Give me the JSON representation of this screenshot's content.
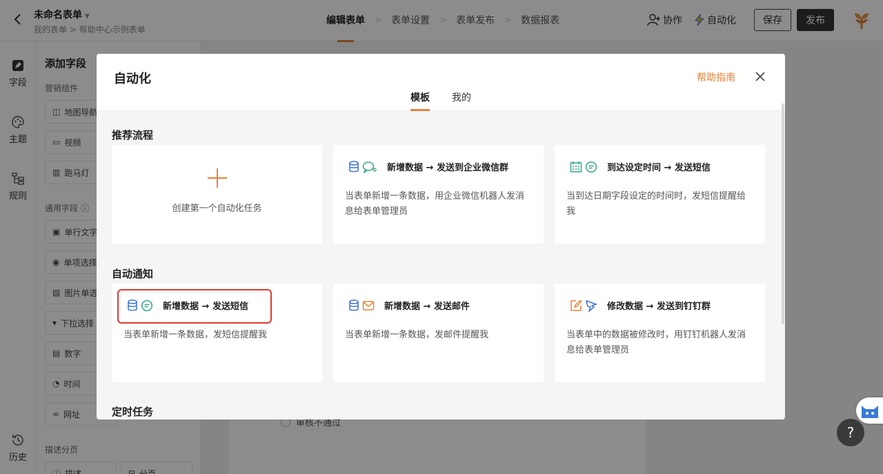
{
  "topbar": {
    "form_title": "未命名表单",
    "breadcrumb": [
      "我的表单",
      "帮助中心示例表单"
    ],
    "steps": [
      "编辑表单",
      "表单设置",
      "表单发布",
      "数据报表"
    ],
    "collab_label": "协作",
    "automation_label": "自动化",
    "save_label": "保存",
    "publish_label": "发布"
  },
  "rail": {
    "items": [
      "字段",
      "主题",
      "规则",
      "历史"
    ]
  },
  "panel": {
    "title": "添加字段",
    "sections": [
      "营销组件",
      "通用字段",
      "描述分页"
    ],
    "marketing_fields": [
      "地图导航",
      "视频",
      "跑马灯"
    ],
    "common_fields": [
      "单行文字",
      "单项选择",
      "图片单选",
      "下拉选择",
      "数字",
      "时间",
      "网址"
    ],
    "desc_fields": [
      "描述",
      "分页"
    ]
  },
  "canvas": {
    "option_text": "审核不通过"
  },
  "modal": {
    "title": "自动化",
    "help_link": "帮助指南",
    "tabs": [
      "模板",
      "我的"
    ],
    "groups": [
      {
        "title": "推荐流程",
        "cards": [
          {
            "title": "",
            "desc": "创建第一个自动化任务"
          },
          {
            "title": "新增数据 → 发送到企业微信群",
            "desc": "当表单新增一条数据，用企业微信机器人发消息给表单管理员"
          },
          {
            "title": "到达设定时间 → 发送短信",
            "desc": "当到达日期字段设定的时间时，发短信提醒给我"
          }
        ]
      },
      {
        "title": "自动通知",
        "cards": [
          {
            "title": "新增数据 → 发送短信",
            "desc": "当表单新增一条数据，发短信提醒我"
          },
          {
            "title": "新增数据 → 发送邮件",
            "desc": "当表单新增一条数据，发邮件提醒我"
          },
          {
            "title": "修改数据 → 发送到钉钉群",
            "desc": "当表单中的数据被修改时，用钉钉机器人发消息给表单管理员"
          }
        ]
      },
      {
        "title": "定时任务",
        "cards": []
      }
    ]
  },
  "help_fab": "?",
  "colors": {
    "accent": "#e8823a",
    "highlight": "#e0392f",
    "blue_icon": "#3b6fd8",
    "green_icon": "#34a58a"
  }
}
